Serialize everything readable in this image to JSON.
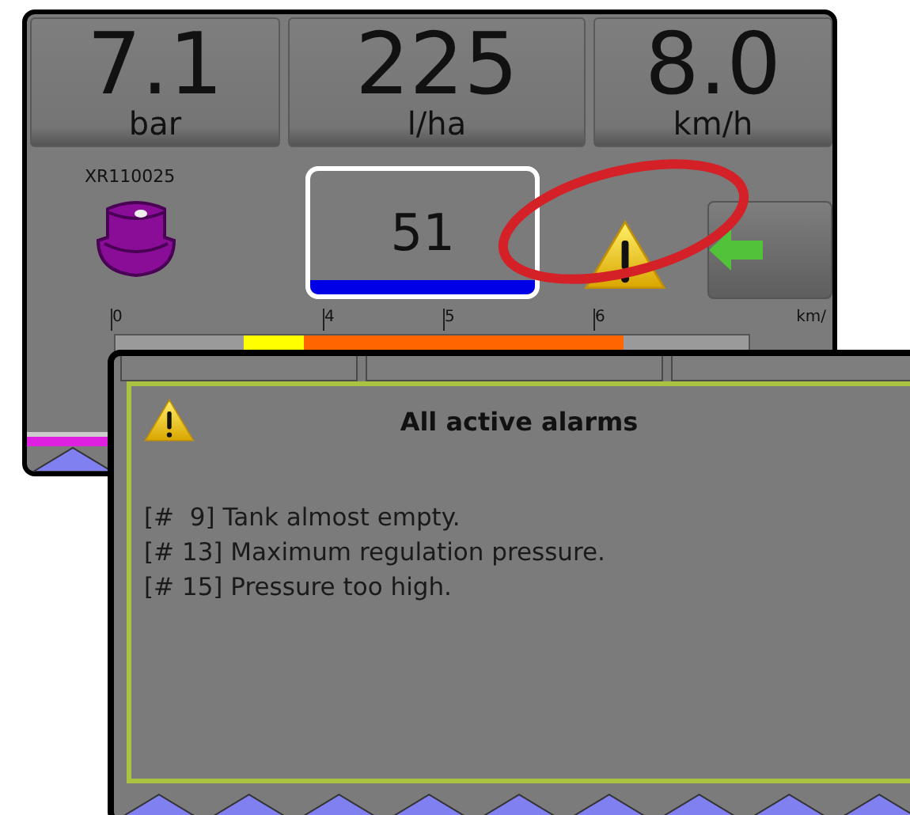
{
  "main_screen": {
    "readouts": [
      {
        "value": "7.1",
        "unit": "bar"
      },
      {
        "value": "225",
        "unit": "l/ha"
      },
      {
        "value": "8.0",
        "unit": "km/h"
      }
    ],
    "nozzle": {
      "label": "XR110025"
    },
    "rate_box": {
      "value": "51"
    },
    "scale": {
      "ticks": [
        "0",
        "4",
        "5",
        "6"
      ],
      "unit": "km/"
    }
  },
  "alarm_dialog": {
    "title": "All active alarms",
    "alarms": [
      "[#  9] Tank almost empty.",
      "[# 13] Maximum regulation pressure.",
      "[# 15] Pressure too high."
    ]
  }
}
